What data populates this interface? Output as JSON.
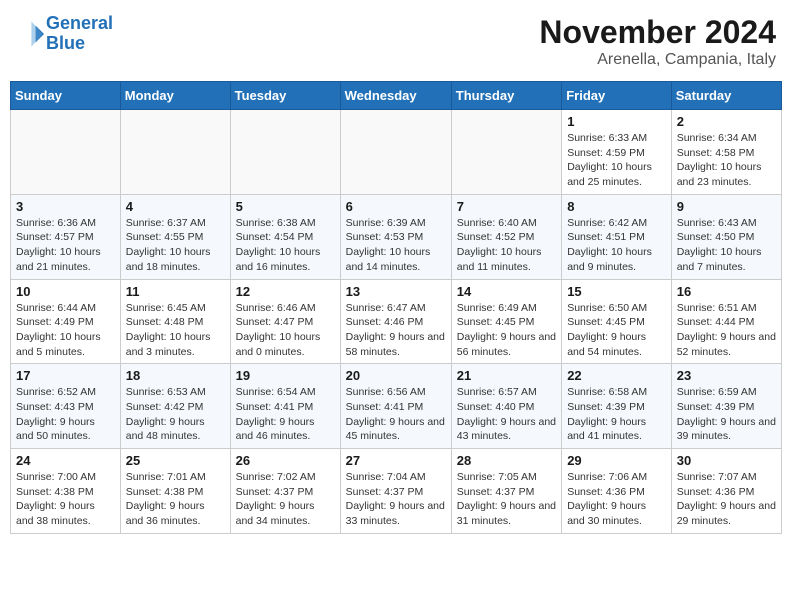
{
  "header": {
    "logo_line1": "General",
    "logo_line2": "Blue",
    "month": "November 2024",
    "location": "Arenella, Campania, Italy"
  },
  "weekdays": [
    "Sunday",
    "Monday",
    "Tuesday",
    "Wednesday",
    "Thursday",
    "Friday",
    "Saturday"
  ],
  "weeks": [
    [
      {
        "day": "",
        "info": ""
      },
      {
        "day": "",
        "info": ""
      },
      {
        "day": "",
        "info": ""
      },
      {
        "day": "",
        "info": ""
      },
      {
        "day": "",
        "info": ""
      },
      {
        "day": "1",
        "info": "Sunrise: 6:33 AM\nSunset: 4:59 PM\nDaylight: 10 hours and 25 minutes."
      },
      {
        "day": "2",
        "info": "Sunrise: 6:34 AM\nSunset: 4:58 PM\nDaylight: 10 hours and 23 minutes."
      }
    ],
    [
      {
        "day": "3",
        "info": "Sunrise: 6:36 AM\nSunset: 4:57 PM\nDaylight: 10 hours and 21 minutes."
      },
      {
        "day": "4",
        "info": "Sunrise: 6:37 AM\nSunset: 4:55 PM\nDaylight: 10 hours and 18 minutes."
      },
      {
        "day": "5",
        "info": "Sunrise: 6:38 AM\nSunset: 4:54 PM\nDaylight: 10 hours and 16 minutes."
      },
      {
        "day": "6",
        "info": "Sunrise: 6:39 AM\nSunset: 4:53 PM\nDaylight: 10 hours and 14 minutes."
      },
      {
        "day": "7",
        "info": "Sunrise: 6:40 AM\nSunset: 4:52 PM\nDaylight: 10 hours and 11 minutes."
      },
      {
        "day": "8",
        "info": "Sunrise: 6:42 AM\nSunset: 4:51 PM\nDaylight: 10 hours and 9 minutes."
      },
      {
        "day": "9",
        "info": "Sunrise: 6:43 AM\nSunset: 4:50 PM\nDaylight: 10 hours and 7 minutes."
      }
    ],
    [
      {
        "day": "10",
        "info": "Sunrise: 6:44 AM\nSunset: 4:49 PM\nDaylight: 10 hours and 5 minutes."
      },
      {
        "day": "11",
        "info": "Sunrise: 6:45 AM\nSunset: 4:48 PM\nDaylight: 10 hours and 3 minutes."
      },
      {
        "day": "12",
        "info": "Sunrise: 6:46 AM\nSunset: 4:47 PM\nDaylight: 10 hours and 0 minutes."
      },
      {
        "day": "13",
        "info": "Sunrise: 6:47 AM\nSunset: 4:46 PM\nDaylight: 9 hours and 58 minutes."
      },
      {
        "day": "14",
        "info": "Sunrise: 6:49 AM\nSunset: 4:45 PM\nDaylight: 9 hours and 56 minutes."
      },
      {
        "day": "15",
        "info": "Sunrise: 6:50 AM\nSunset: 4:45 PM\nDaylight: 9 hours and 54 minutes."
      },
      {
        "day": "16",
        "info": "Sunrise: 6:51 AM\nSunset: 4:44 PM\nDaylight: 9 hours and 52 minutes."
      }
    ],
    [
      {
        "day": "17",
        "info": "Sunrise: 6:52 AM\nSunset: 4:43 PM\nDaylight: 9 hours and 50 minutes."
      },
      {
        "day": "18",
        "info": "Sunrise: 6:53 AM\nSunset: 4:42 PM\nDaylight: 9 hours and 48 minutes."
      },
      {
        "day": "19",
        "info": "Sunrise: 6:54 AM\nSunset: 4:41 PM\nDaylight: 9 hours and 46 minutes."
      },
      {
        "day": "20",
        "info": "Sunrise: 6:56 AM\nSunset: 4:41 PM\nDaylight: 9 hours and 45 minutes."
      },
      {
        "day": "21",
        "info": "Sunrise: 6:57 AM\nSunset: 4:40 PM\nDaylight: 9 hours and 43 minutes."
      },
      {
        "day": "22",
        "info": "Sunrise: 6:58 AM\nSunset: 4:39 PM\nDaylight: 9 hours and 41 minutes."
      },
      {
        "day": "23",
        "info": "Sunrise: 6:59 AM\nSunset: 4:39 PM\nDaylight: 9 hours and 39 minutes."
      }
    ],
    [
      {
        "day": "24",
        "info": "Sunrise: 7:00 AM\nSunset: 4:38 PM\nDaylight: 9 hours and 38 minutes."
      },
      {
        "day": "25",
        "info": "Sunrise: 7:01 AM\nSunset: 4:38 PM\nDaylight: 9 hours and 36 minutes."
      },
      {
        "day": "26",
        "info": "Sunrise: 7:02 AM\nSunset: 4:37 PM\nDaylight: 9 hours and 34 minutes."
      },
      {
        "day": "27",
        "info": "Sunrise: 7:04 AM\nSunset: 4:37 PM\nDaylight: 9 hours and 33 minutes."
      },
      {
        "day": "28",
        "info": "Sunrise: 7:05 AM\nSunset: 4:37 PM\nDaylight: 9 hours and 31 minutes."
      },
      {
        "day": "29",
        "info": "Sunrise: 7:06 AM\nSunset: 4:36 PM\nDaylight: 9 hours and 30 minutes."
      },
      {
        "day": "30",
        "info": "Sunrise: 7:07 AM\nSunset: 4:36 PM\nDaylight: 9 hours and 29 minutes."
      }
    ]
  ]
}
